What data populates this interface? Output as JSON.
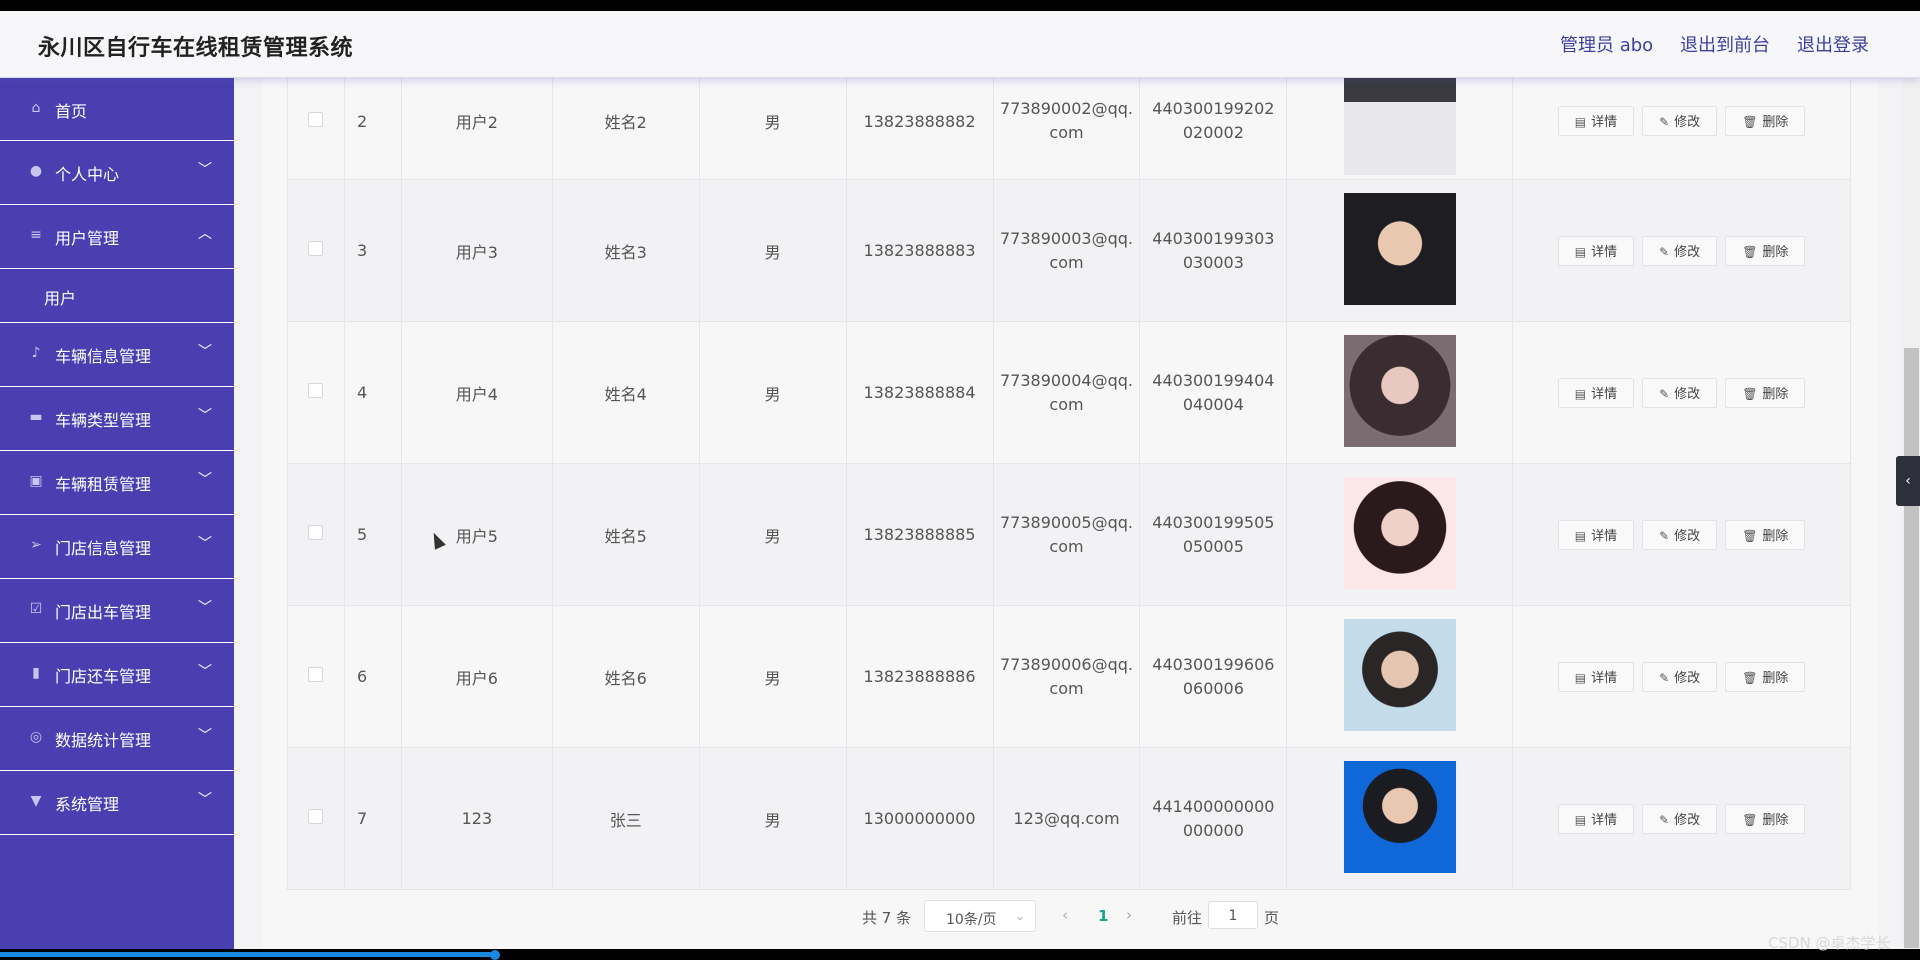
{
  "header": {
    "title": "永川区自行车在线租赁管理系统",
    "admin_label": "管理员 abo",
    "front_label": "退出到前台",
    "logout_label": "退出登录"
  },
  "sidebar": {
    "items": [
      {
        "label": "首页",
        "icon": "home-icon",
        "expandable": false
      },
      {
        "label": "个人中心",
        "icon": "user-icon",
        "expandable": true
      },
      {
        "label": "用户管理",
        "icon": "list-icon",
        "expandable": true,
        "expanded": true,
        "children": [
          "用户"
        ]
      },
      {
        "label": "车辆信息管理",
        "icon": "mic-icon",
        "expandable": true
      },
      {
        "label": "车辆类型管理",
        "icon": "chat-icon",
        "expandable": true
      },
      {
        "label": "车辆租赁管理",
        "icon": "clipboard-icon",
        "expandable": true
      },
      {
        "label": "门店信息管理",
        "icon": "send-icon",
        "expandable": true
      },
      {
        "label": "门店出车管理",
        "icon": "check-icon",
        "expandable": true
      },
      {
        "label": "门店还车管理",
        "icon": "bookmark-icon",
        "expandable": true
      },
      {
        "label": "数据统计管理",
        "icon": "chart-icon",
        "expandable": true
      },
      {
        "label": "系统管理",
        "icon": "settings-icon",
        "expandable": true
      }
    ]
  },
  "table": {
    "rows": [
      {
        "no": "2",
        "account": "用户2",
        "name": "姓名2",
        "gender": "男",
        "phone": "13823888882",
        "email": "773890002@qq.com",
        "id_card": "440300199202020002",
        "photo": "photo-2"
      },
      {
        "no": "3",
        "account": "用户3",
        "name": "姓名3",
        "gender": "男",
        "phone": "13823888883",
        "email": "773890003@qq.com",
        "id_card": "440300199303030003",
        "photo": "photo-3"
      },
      {
        "no": "4",
        "account": "用户4",
        "name": "姓名4",
        "gender": "男",
        "phone": "13823888884",
        "email": "773890004@qq.com",
        "id_card": "440300199404040004",
        "photo": "photo-4"
      },
      {
        "no": "5",
        "account": "用户5",
        "name": "姓名5",
        "gender": "男",
        "phone": "13823888885",
        "email": "773890005@qq.com",
        "id_card": "440300199505050005",
        "photo": "photo-5"
      },
      {
        "no": "6",
        "account": "用户6",
        "name": "姓名6",
        "gender": "男",
        "phone": "13823888886",
        "email": "773890006@qq.com",
        "id_card": "440300199606060006",
        "photo": "photo-6"
      },
      {
        "no": "7",
        "account": "123",
        "name": "张三",
        "gender": "男",
        "phone": "13000000000",
        "email": "123@qq.com",
        "id_card": "441400000000000000",
        "photo": "photo-7"
      }
    ],
    "actions": {
      "detail": "详情",
      "edit": "修改",
      "delete": "删除"
    }
  },
  "pagination": {
    "total": "共 7 条",
    "page_size": "10条/页",
    "current_page": "1",
    "goto_label": "前往",
    "goto_value": "1",
    "page_suffix": "页"
  },
  "watermark": "CSDN @卓杰学长",
  "colors": {
    "sidebar": "#4a3fb0",
    "accent": "#17a589"
  }
}
